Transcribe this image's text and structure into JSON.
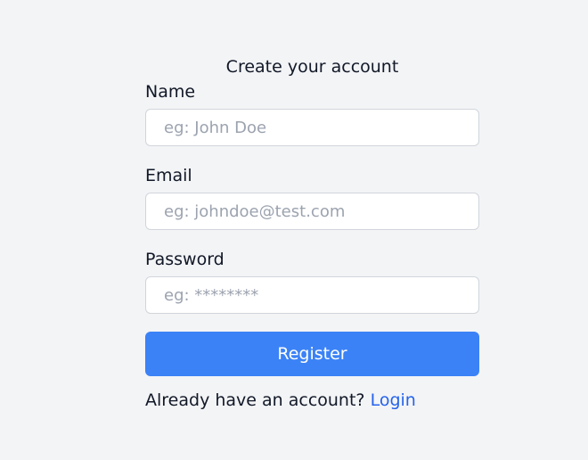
{
  "form": {
    "title": "Create your account",
    "name": {
      "label": "Name",
      "placeholder": "eg: John Doe",
      "value": ""
    },
    "email": {
      "label": "Email",
      "placeholder": "eg: johndoe@test.com",
      "value": ""
    },
    "password": {
      "label": "Password",
      "placeholder": "eg: ********",
      "value": ""
    },
    "register_label": "Register",
    "footer_text": "Already have an account?",
    "login_label": "Login"
  },
  "colors": {
    "background": "#f3f4f6",
    "primary_button": "#3b82f6",
    "link": "#2563eb",
    "input_border": "#d1d5db",
    "placeholder": "#9ca3af"
  }
}
